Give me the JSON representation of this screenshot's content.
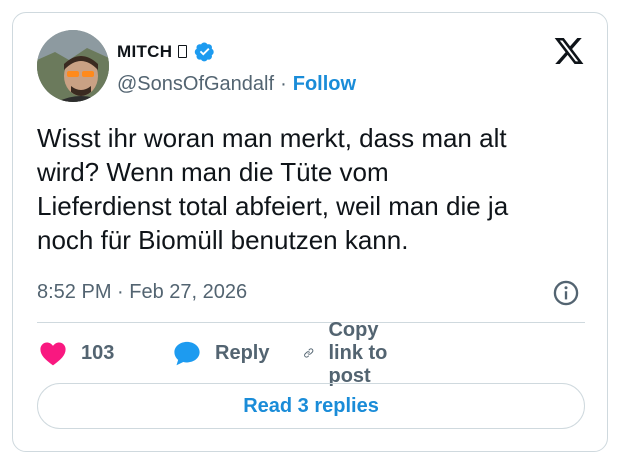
{
  "author": {
    "name": "MITCH",
    "handle": "@SonsOfGandalf",
    "separator": "·",
    "follow_label": "Follow"
  },
  "tweet": {
    "lines": [
      "Wisst ihr woran man merkt, dass man alt",
      "wird? Wenn man die Tüte vom",
      "Lieferdienst total abfeiert, weil man die ja",
      "noch für Biomüll benutzen kann."
    ],
    "timestamp": "8:52 PM · Feb 27, 2026"
  },
  "actions": {
    "like_count": "103",
    "reply_label": "Reply",
    "copy_link_label": "Copy link to post"
  },
  "replies_button": "Read 3 replies",
  "icons": {
    "verified": "verified-badge-icon",
    "logo": "x-logo-icon",
    "info": "info-icon",
    "like": "heart-icon",
    "reply": "speech-bubble-icon",
    "link": "link-icon"
  },
  "colors": {
    "accent": "#1d9bf0",
    "like": "#f91880",
    "text_secondary": "#536471"
  }
}
